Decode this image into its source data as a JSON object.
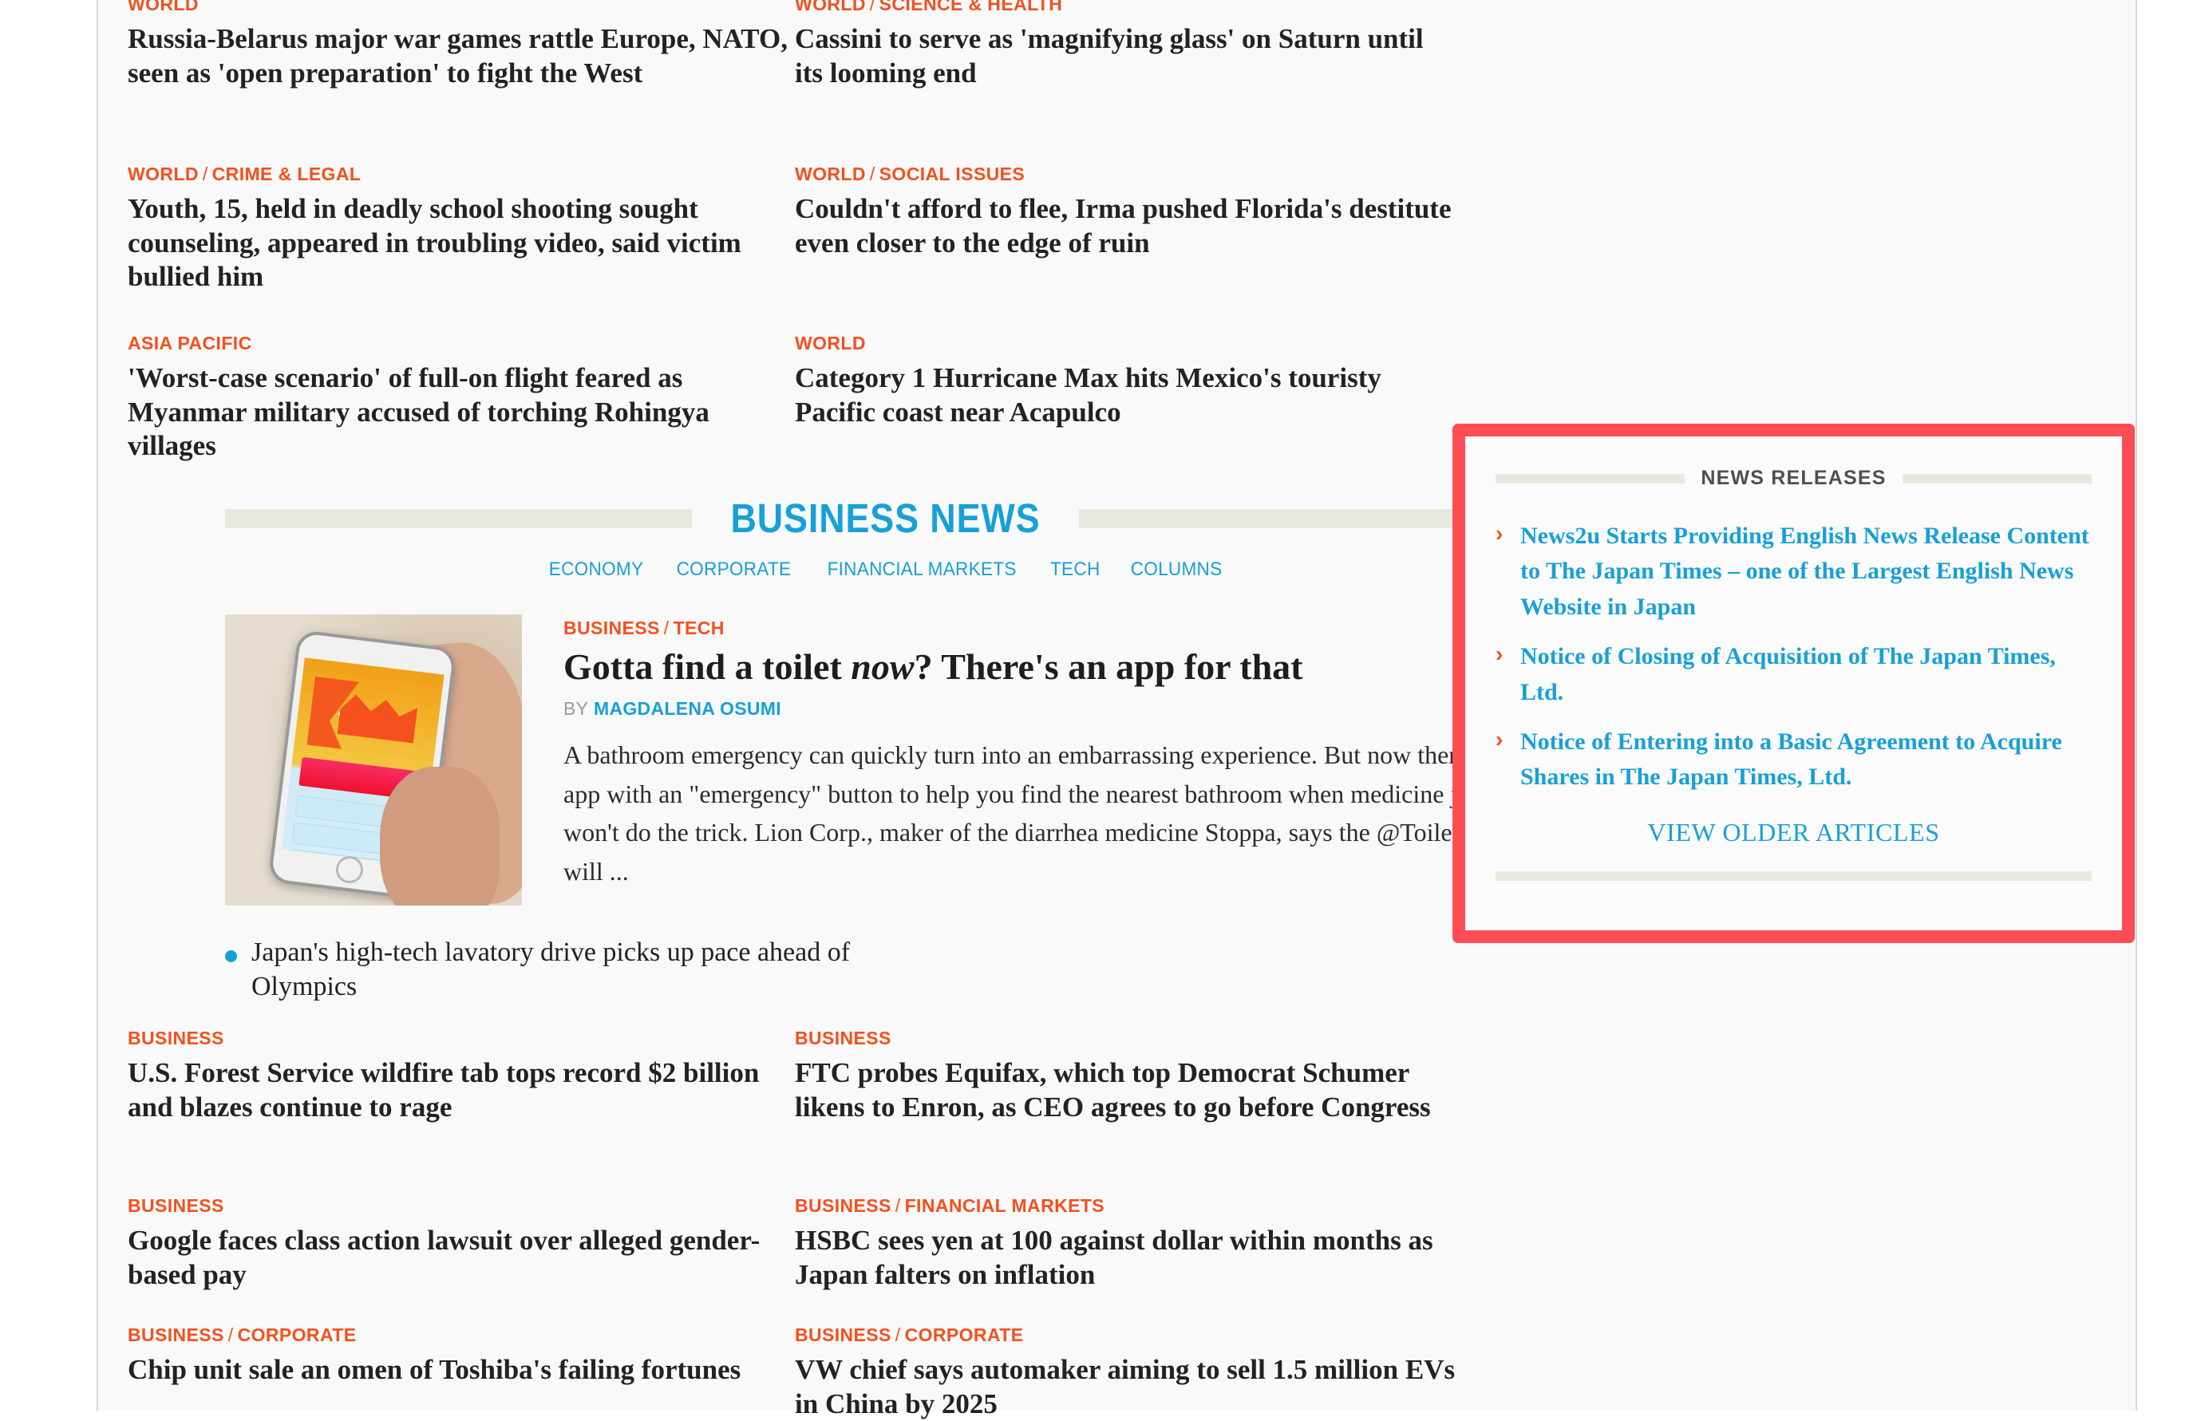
{
  "top_news": {
    "left_column": [
      {
        "categories": [
          "WORLD"
        ],
        "headline": "Russia-Belarus major war games rattle Europe, NATO, seen as 'open preparation' to fight the West"
      },
      {
        "categories": [
          "WORLD",
          "CRIME & LEGAL"
        ],
        "headline": "Youth, 15, held in deadly school shooting sought counseling, appeared in troubling video, said victim bullied him"
      },
      {
        "categories": [
          "ASIA PACIFIC"
        ],
        "headline": "'Worst-case scenario' of full-on flight feared as Myanmar military accused of torching Rohingya villages"
      }
    ],
    "right_column": [
      {
        "categories": [
          "WORLD",
          "SCIENCE & HEALTH"
        ],
        "headline": "Cassini to serve as 'magnifying glass' on Saturn until its looming end"
      },
      {
        "categories": [
          "WORLD",
          "SOCIAL ISSUES"
        ],
        "headline": "Couldn't afford to flee, Irma pushed Florida's destitute even closer to the edge of ruin"
      },
      {
        "categories": [
          "WORLD"
        ],
        "headline": "Category 1 Hurricane Max hits Mexico's touristy Pacific coast near Acapulco"
      }
    ]
  },
  "business_section": {
    "title": "BUSINESS NEWS",
    "nav": [
      {
        "label": "ECONOMY"
      },
      {
        "label": "CORPORATE"
      },
      {
        "label": "FINANCIAL MARKETS"
      },
      {
        "label": "TECH"
      },
      {
        "label": "COLUMNS"
      }
    ],
    "feature": {
      "categories": [
        "BUSINESS",
        "TECH"
      ],
      "headline_part1": "Gotta find a toilet ",
      "headline_em": "now",
      "headline_part2": "? There's an app for that",
      "by_label": "BY",
      "author": "MAGDALENA OSUMI",
      "summary": "A bathroom emergency can quickly turn into an embarrassing experience. But now there's an app with an \"emergency\" button to help you find the nearest bathroom when medicine just won't do the trick. Lion Corp., maker of the diarrhea medicine Stoppa, says the @Toilet app will ...",
      "thumbnail_alt": "Hand holding a white smartphone displaying the @Toilet app with an orange logo and pink emergency button",
      "related_bullet": "Japan's high-tech lavatory drive picks up pace ahead of Olympics"
    },
    "grid": [
      {
        "categories": [
          "BUSINESS"
        ],
        "headline": "U.S. Forest Service wildfire tab tops record $2 billion and blazes continue to rage"
      },
      {
        "categories": [
          "BUSINESS"
        ],
        "headline": "FTC probes Equifax, which top Democrat Schumer likens to Enron, as CEO agrees to go before Congress"
      },
      {
        "categories": [
          "BUSINESS"
        ],
        "headline": "Google faces class action lawsuit over alleged gender-based pay"
      },
      {
        "categories": [
          "BUSINESS",
          "FINANCIAL MARKETS"
        ],
        "headline": "HSBC sees yen at 100 against dollar within months as Japan falters on inflation"
      },
      {
        "categories": [
          "BUSINESS",
          "CORPORATE"
        ],
        "headline": "Chip unit sale an omen of Toshiba's failing fortunes"
      },
      {
        "categories": [
          "BUSINESS",
          "CORPORATE"
        ],
        "headline": "VW chief says automaker aiming to sell 1.5 million EVs in China by 2025"
      }
    ]
  },
  "news_releases": {
    "title": "NEWS RELEASES",
    "items": [
      {
        "chevron": "chevron-right-icon",
        "label": "News2u Starts Providing English News Release Content to The Japan Times – one of the Largest English News Website in Japan"
      },
      {
        "chevron": "chevron-right-icon",
        "label": "Notice of Closing of Acquisition of The Japan Times, Ltd."
      },
      {
        "chevron": "chevron-right-icon",
        "label": "Notice of Entering into a Basic Agreement to Acquire Shares in The Japan Times, Ltd."
      }
    ],
    "view_older": "VIEW OLDER ARTICLES",
    "highlight_color": "#ff4d55"
  },
  "colors": {
    "kicker": "#f4501e",
    "link_blue": "#17a0d8",
    "headline": "#222222",
    "page_bg": "#f9f9f9",
    "rule": "#e8e8df"
  }
}
